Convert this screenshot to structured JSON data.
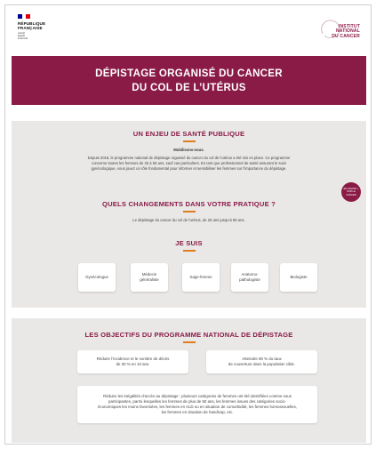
{
  "colors": {
    "brand": "#8a1b47",
    "section_bg": "#e9e8e6",
    "accent_rule": "#e07d1a",
    "flag_blue": "#000091",
    "flag_white": "#ffffff",
    "flag_red": "#e1000f"
  },
  "header": {
    "rf_logo": {
      "line1": "RÉPUBLIQUE",
      "line2": "FRANÇAISE",
      "motto1": "Liberté",
      "motto2": "Égalité",
      "motto3": "Fraternité"
    },
    "inca_logo": {
      "line1": "INSTITUT",
      "line2": "NATIONAL",
      "line3": "DU CANCER"
    }
  },
  "banner": {
    "title_line1": "DÉPISTAGE ORGANISÉ DU CANCER",
    "title_line2": "DU COL DE L’UTÉRUS"
  },
  "enjeu": {
    "title": "UN ENJEU DE SANTÉ PUBLIQUE",
    "subtitle": "Mobilisons-nous.",
    "text1": "Depuis 2018, le programme national de dépistage organisé du cancer du col de l’utérus a été mis en place. Ce programme",
    "text2": "concerne toutes les femmes de 25 à 65 ans, sauf cas particuliers. En tant que professionnel de santé assurant le suivi",
    "text3": "gynécologique, vous jouez un rôle fondamental pour informer et sensibiliser les femmes sur l’importance du dépistage."
  },
  "badge": {
    "line1": "EN SAVOIR +",
    "line2": "SUR LE",
    "line3": "CANCER"
  },
  "changements": {
    "title": "QUELS CHANGEMENTS DANS VOTRE PRATIQUE ?",
    "text": "Le dépistage du cancer du col de l’utérus, de 25 ans jusqu’à 65 ans."
  },
  "je_suis": {
    "title": "JE SUIS",
    "options": [
      {
        "label": "Gynécologue"
      },
      {
        "label1": "Médecin",
        "label2": "généraliste"
      },
      {
        "label": "Sage-femme"
      },
      {
        "label1": "Anatomo-",
        "label2": "pathologiste"
      },
      {
        "label": "Biologiste"
      }
    ]
  },
  "objectifs": {
    "title": "LES OBJECTIFS DU PROGRAMME NATIONAL DE DÉPISTAGE",
    "card1_line1": "Réduire l’incidence et le nombre de décès",
    "card1_line2": "de 30 % en 10 ans.",
    "card2_line1": "Atteindre 80 % du taux",
    "card2_line2": "de couverture dans la population cible.",
    "card3_line1": "Réduire les inégalités d’accès au dépistage : plusieurs catégories de femmes ont été identifiées comme sous",
    "card3_line2": "participantes, parmi lesquelles les femmes de plus de 50 ans, les femmes issues des catégories socio-",
    "card3_line3": "économiques les moins favorisées, les femmes en ALD ou en situation de comorbidité, les femmes homosexuelles,",
    "card3_line4": "les femmes en situation de handicap, etc."
  }
}
